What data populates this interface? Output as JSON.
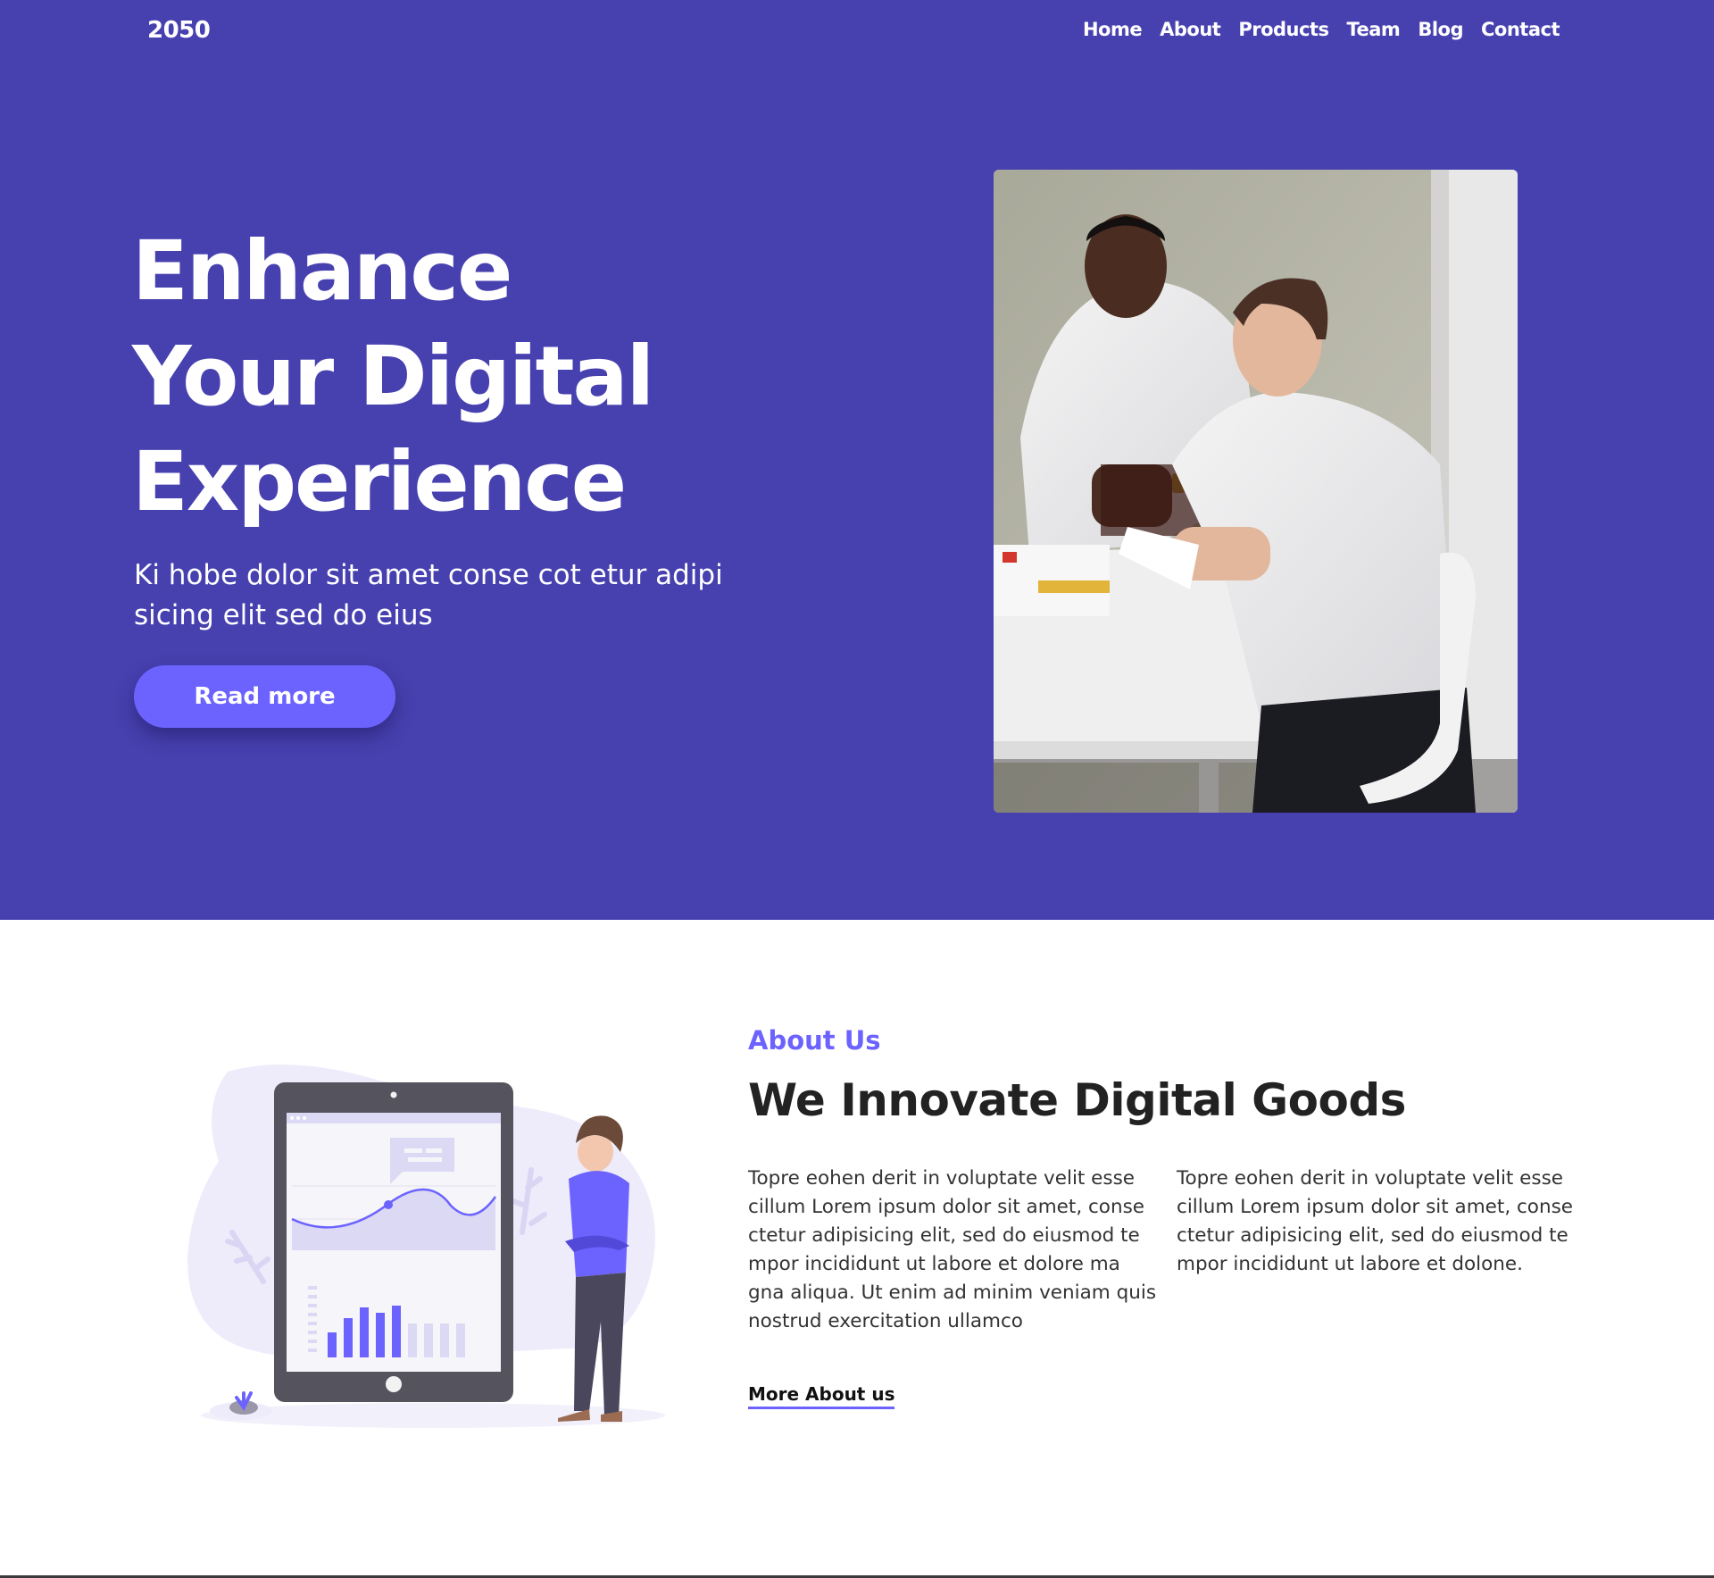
{
  "nav": {
    "brand": "2050",
    "links": [
      "Home",
      "About",
      "Products",
      "Team",
      "Blog",
      "Contact"
    ]
  },
  "hero": {
    "title_lines": [
      "Enhance",
      "Your Digital",
      "Experience"
    ],
    "subtitle": "Ki hobe dolor sit amet conse cot etur adipi sicing elit sed do eius",
    "button_label": "Read more",
    "image": "photo-two-men-working-at-desk"
  },
  "about": {
    "kicker": "About Us",
    "title": "We Innovate Digital Goods",
    "col1": "Topre eohen derit in voluptate velit esse cillum Lorem ipsum dolor sit amet, conse ctetur adipisicing elit, sed do eiusmod te mpor incididunt ut labore et dolore ma gna aliqua. Ut enim ad minim veniam quis nostrud exercitation ullamco",
    "col2": "Topre eohen derit in voluptate velit esse cillum Lorem ipsum dolor sit amet, conse ctetur adipisicing elit, sed do eiusmod te mpor incididunt ut labore et dolone.",
    "link_label": "More About us",
    "illustration": "person-with-tablet-analytics-illustration"
  },
  "colors": {
    "hero_bg": "#4741B0",
    "accent": "#6C63FF",
    "text_dark": "#222222"
  }
}
